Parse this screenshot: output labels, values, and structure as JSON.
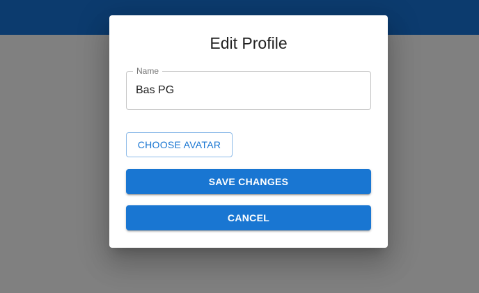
{
  "dialog": {
    "title": "Edit Profile",
    "name_field": {
      "label": "Name",
      "value": "Bas PG"
    },
    "choose_avatar_label": "CHOOSE AVATAR",
    "save_label": "SAVE CHANGES",
    "cancel_label": "CANCEL"
  },
  "colors": {
    "app_bar": "#0c3b6e",
    "backdrop": "#808080",
    "primary": "#1976d2"
  }
}
